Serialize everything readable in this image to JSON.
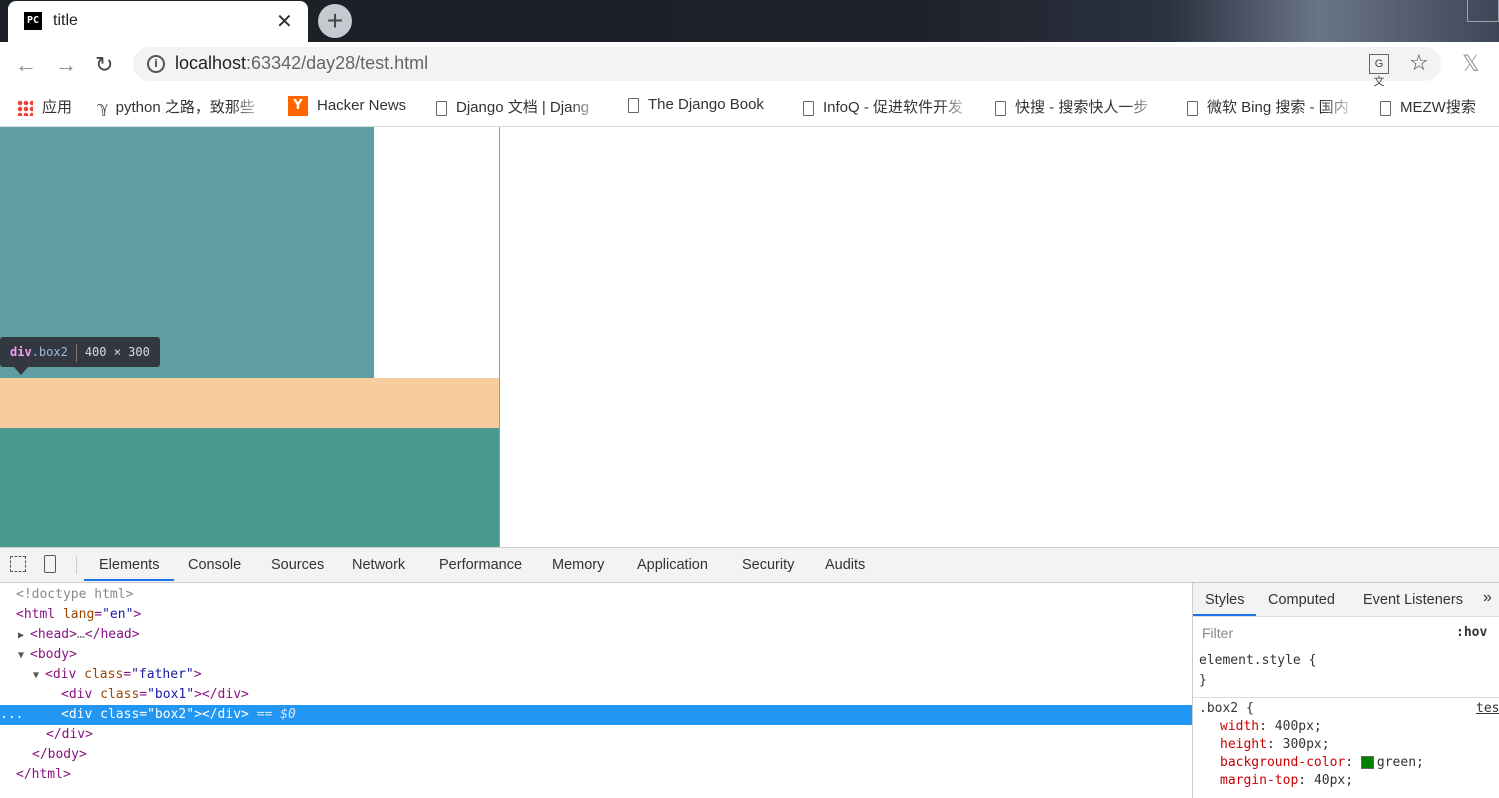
{
  "tab": {
    "favicon_text": "PC",
    "title": "title",
    "close": "✕",
    "new_tab": "+"
  },
  "toolbar": {
    "back": "←",
    "forward": "→",
    "reload": "↻",
    "url_host": "localhost",
    "url_rest": ":63342/day28/test.html",
    "info": "i",
    "translate": "G文",
    "star": "☆"
  },
  "bookmarks": [
    {
      "label": "应用",
      "icon": "apps-icon"
    },
    {
      "label": "python 之路，致那些",
      "icon": "page-icon"
    },
    {
      "label": "Hacker News",
      "icon": "ycombinator-icon",
      "icon_text": "Y"
    },
    {
      "label": "Django 文档 | Djang",
      "icon": "page-icon"
    },
    {
      "label": "The Django Book",
      "icon": "page-icon"
    },
    {
      "label": "InfoQ - 促进软件开发",
      "icon": "page-icon"
    },
    {
      "label": "快搜 - 搜索快人一步",
      "icon": "page-icon"
    },
    {
      "label": "微软 Bing 搜索 - 国内",
      "icon": "page-icon"
    },
    {
      "label": "MEZW搜索",
      "icon": "page-icon"
    }
  ],
  "tooltip": {
    "tag": "div",
    "cls": ".box2",
    "size": "400 × 300"
  },
  "devtools": {
    "tabs": [
      "Elements",
      "Console",
      "Sources",
      "Network",
      "Performance",
      "Memory",
      "Application",
      "Security",
      "Audits"
    ],
    "active_tab": "Elements"
  },
  "dom": {
    "doctype": "<!doctype html>",
    "html_open": "<html",
    "html_attr": "lang",
    "html_val": "\"en\"",
    "head_open": "<head>",
    "head_ellipsis": "…",
    "head_close": "</head>",
    "body_open": "<body>",
    "div_open": "<div",
    "class_attr": "class",
    "father_val": "\"father\"",
    "box1_val": "\"box1\"",
    "box2_val": "\"box2\"",
    "div_close": "</div>",
    "body_close": "</body>",
    "html_close": "</html>",
    "selected_marker": "== $0",
    "dots": "..."
  },
  "styles": {
    "tabs": [
      "Styles",
      "Computed",
      "Event Listeners"
    ],
    "more": "»",
    "filter_placeholder": "Filter",
    "hov": ":hov",
    "element_style": "element.style {",
    "close_brace": "}",
    "selector": ".box2 {",
    "source": "tes",
    "props": [
      {
        "name": "width",
        "value": "400px;"
      },
      {
        "name": "height",
        "value": "300px;"
      },
      {
        "name": "background-color",
        "value": "green;",
        "swatch": "#008000"
      },
      {
        "name": "margin-top",
        "value": "40px;"
      }
    ]
  },
  "colors": {
    "box1": "#5f9ea0",
    "margin_highlight": "#f9cc9d",
    "box2": "#4a9a90",
    "selection": "#2196f3"
  }
}
